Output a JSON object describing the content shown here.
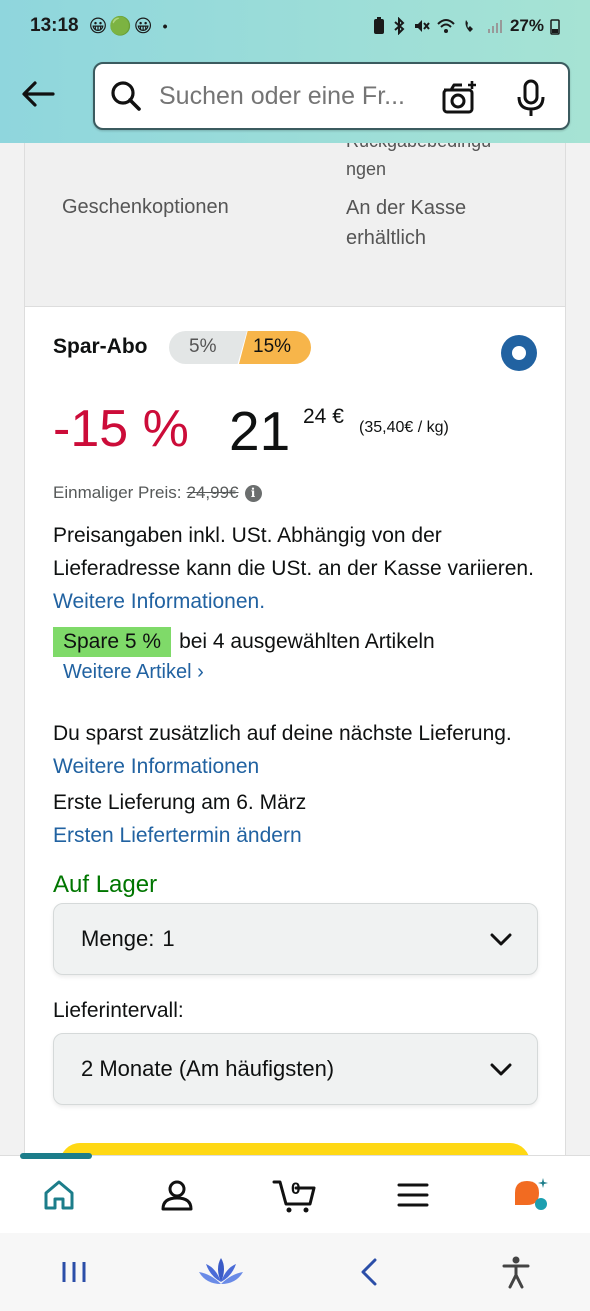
{
  "status_bar": {
    "time": "13:18",
    "emoji_1": "😀",
    "emoji_2": "🟢",
    "emoji_3": "😀",
    "dot": "•",
    "battery": "27%"
  },
  "search": {
    "placeholder": "Suchen oder eine Fr..."
  },
  "info_table": {
    "cut_text": "Rückgabebedingu",
    "cut_text_2": "ngen",
    "gift_label": "Geschenkoptionen",
    "gift_value": "An der Kasse erhältlich"
  },
  "subscription": {
    "title": "Spar-Abo",
    "pill_left": "5%",
    "pill_right": "15%",
    "discount": "-15 %",
    "price_whole": "21",
    "price_frac": "24 €",
    "unit_price": "(35,40€ / kg)",
    "once_label": "Einmaliger Preis:",
    "once_price": "24,99€",
    "tax_text": "Preisangaben inkl. USt. Abhängig von der Lieferadresse kann die USt. an der Kasse variieren.",
    "tax_link": "Weitere Informationen.",
    "spare_badge": "Spare 5 %",
    "spare_text": "bei 4 ausgewählten Artikeln",
    "more_items": "Weitere Artikel ›",
    "save_text": "Du sparst zusätzlich auf deine nächste Lieferung.",
    "save_link": "Weitere Informationen",
    "first_delivery": "Erste Lieferung am 6. März",
    "change_date": "Ersten Liefertermin ändern",
    "stock": "Auf Lager",
    "qty_label": "Menge:",
    "qty_value": "1",
    "interval_label": "Lieferintervall:",
    "interval_value": "2 Monate (Am häufigsten)"
  },
  "bottom_nav": {
    "cart_count": "0"
  },
  "colors": {
    "accent": "#2162a1",
    "discount": "#cc0c39",
    "stock": "#007600",
    "badge": "#7fda69",
    "header": "#8fd6dd"
  }
}
